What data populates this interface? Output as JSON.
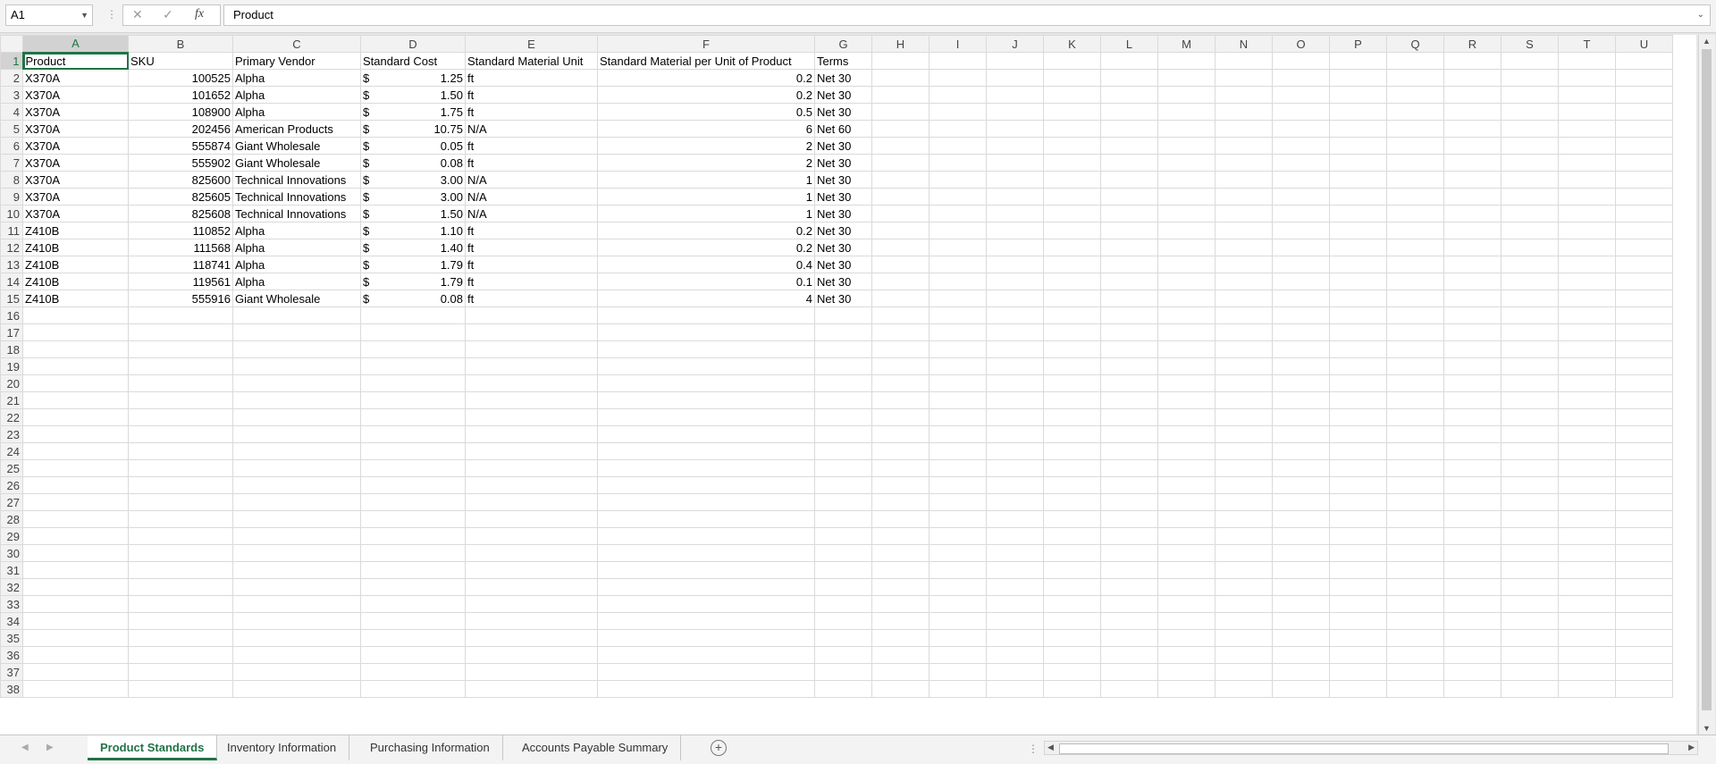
{
  "formula_bar": {
    "name_box": "A1",
    "cancel_icon": "✕",
    "enter_icon": "✓",
    "fx_label": "fx",
    "formula": "Product"
  },
  "columns": [
    "A",
    "B",
    "C",
    "D",
    "E",
    "F",
    "G",
    "H",
    "I",
    "J",
    "K",
    "L",
    "M",
    "N",
    "O",
    "P",
    "Q",
    "R",
    "S",
    "T",
    "U"
  ],
  "selected_cell": "A1",
  "header_row": {
    "product": "Product",
    "sku": "SKU",
    "vendor": "Primary Vendor",
    "cost": "Standard Cost",
    "unit": "Standard Material Unit",
    "per_unit": "Standard Material per Unit of Product",
    "terms": "Terms"
  },
  "rows": [
    {
      "product": "X370A",
      "sku": "100525",
      "vendor": "Alpha",
      "cur": "$",
      "cost": "1.25",
      "unit": "ft",
      "per_unit": "0.2",
      "terms": "Net 30"
    },
    {
      "product": "X370A",
      "sku": "101652",
      "vendor": "Alpha",
      "cur": "$",
      "cost": "1.50",
      "unit": "ft",
      "per_unit": "0.2",
      "terms": "Net 30"
    },
    {
      "product": "X370A",
      "sku": "108900",
      "vendor": "Alpha",
      "cur": "$",
      "cost": "1.75",
      "unit": "ft",
      "per_unit": "0.5",
      "terms": "Net 30"
    },
    {
      "product": "X370A",
      "sku": "202456",
      "vendor": "American Products",
      "cur": "$",
      "cost": "10.75",
      "unit": "N/A",
      "per_unit": "6",
      "terms": "Net 60"
    },
    {
      "product": "X370A",
      "sku": "555874",
      "vendor": "Giant Wholesale",
      "cur": "$",
      "cost": "0.05",
      "unit": "ft",
      "per_unit": "2",
      "terms": "Net 30"
    },
    {
      "product": "X370A",
      "sku": "555902",
      "vendor": "Giant Wholesale",
      "cur": "$",
      "cost": "0.08",
      "unit": "ft",
      "per_unit": "2",
      "terms": "Net 30"
    },
    {
      "product": "X370A",
      "sku": "825600",
      "vendor": "Technical Innovations",
      "cur": "$",
      "cost": "3.00",
      "unit": "N/A",
      "per_unit": "1",
      "terms": "Net 30"
    },
    {
      "product": "X370A",
      "sku": "825605",
      "vendor": "Technical Innovations",
      "cur": "$",
      "cost": "3.00",
      "unit": "N/A",
      "per_unit": "1",
      "terms": "Net 30"
    },
    {
      "product": "X370A",
      "sku": "825608",
      "vendor": "Technical Innovations",
      "cur": "$",
      "cost": "1.50",
      "unit": "N/A",
      "per_unit": "1",
      "terms": "Net 30"
    },
    {
      "product": "Z410B",
      "sku": "110852",
      "vendor": "Alpha",
      "cur": "$",
      "cost": "1.10",
      "unit": "ft",
      "per_unit": "0.2",
      "terms": "Net 30"
    },
    {
      "product": "Z410B",
      "sku": "111568",
      "vendor": "Alpha",
      "cur": "$",
      "cost": "1.40",
      "unit": "ft",
      "per_unit": "0.2",
      "terms": "Net 30"
    },
    {
      "product": "Z410B",
      "sku": "118741",
      "vendor": "Alpha",
      "cur": "$",
      "cost": "1.79",
      "unit": "ft",
      "per_unit": "0.4",
      "terms": "Net 30"
    },
    {
      "product": "Z410B",
      "sku": "119561",
      "vendor": "Alpha",
      "cur": "$",
      "cost": "1.79",
      "unit": "ft",
      "per_unit": "0.1",
      "terms": "Net 30"
    },
    {
      "product": "Z410B",
      "sku": "555916",
      "vendor": "Giant Wholesale",
      "cur": "$",
      "cost": "0.08",
      "unit": "ft",
      "per_unit": "4",
      "terms": "Net 30"
    }
  ],
  "total_rows_visible": 38,
  "sheet_tabs": [
    {
      "label": "Product Standards",
      "active": true
    },
    {
      "label": "Inventory Information",
      "active": false
    },
    {
      "label": "Purchasing Information",
      "active": false
    },
    {
      "label": "Accounts Payable Summary",
      "active": false
    }
  ],
  "add_sheet_icon": "+",
  "colors": {
    "accent": "#217346",
    "header_bg": "#f2f2f2",
    "gridline": "#dadada"
  }
}
